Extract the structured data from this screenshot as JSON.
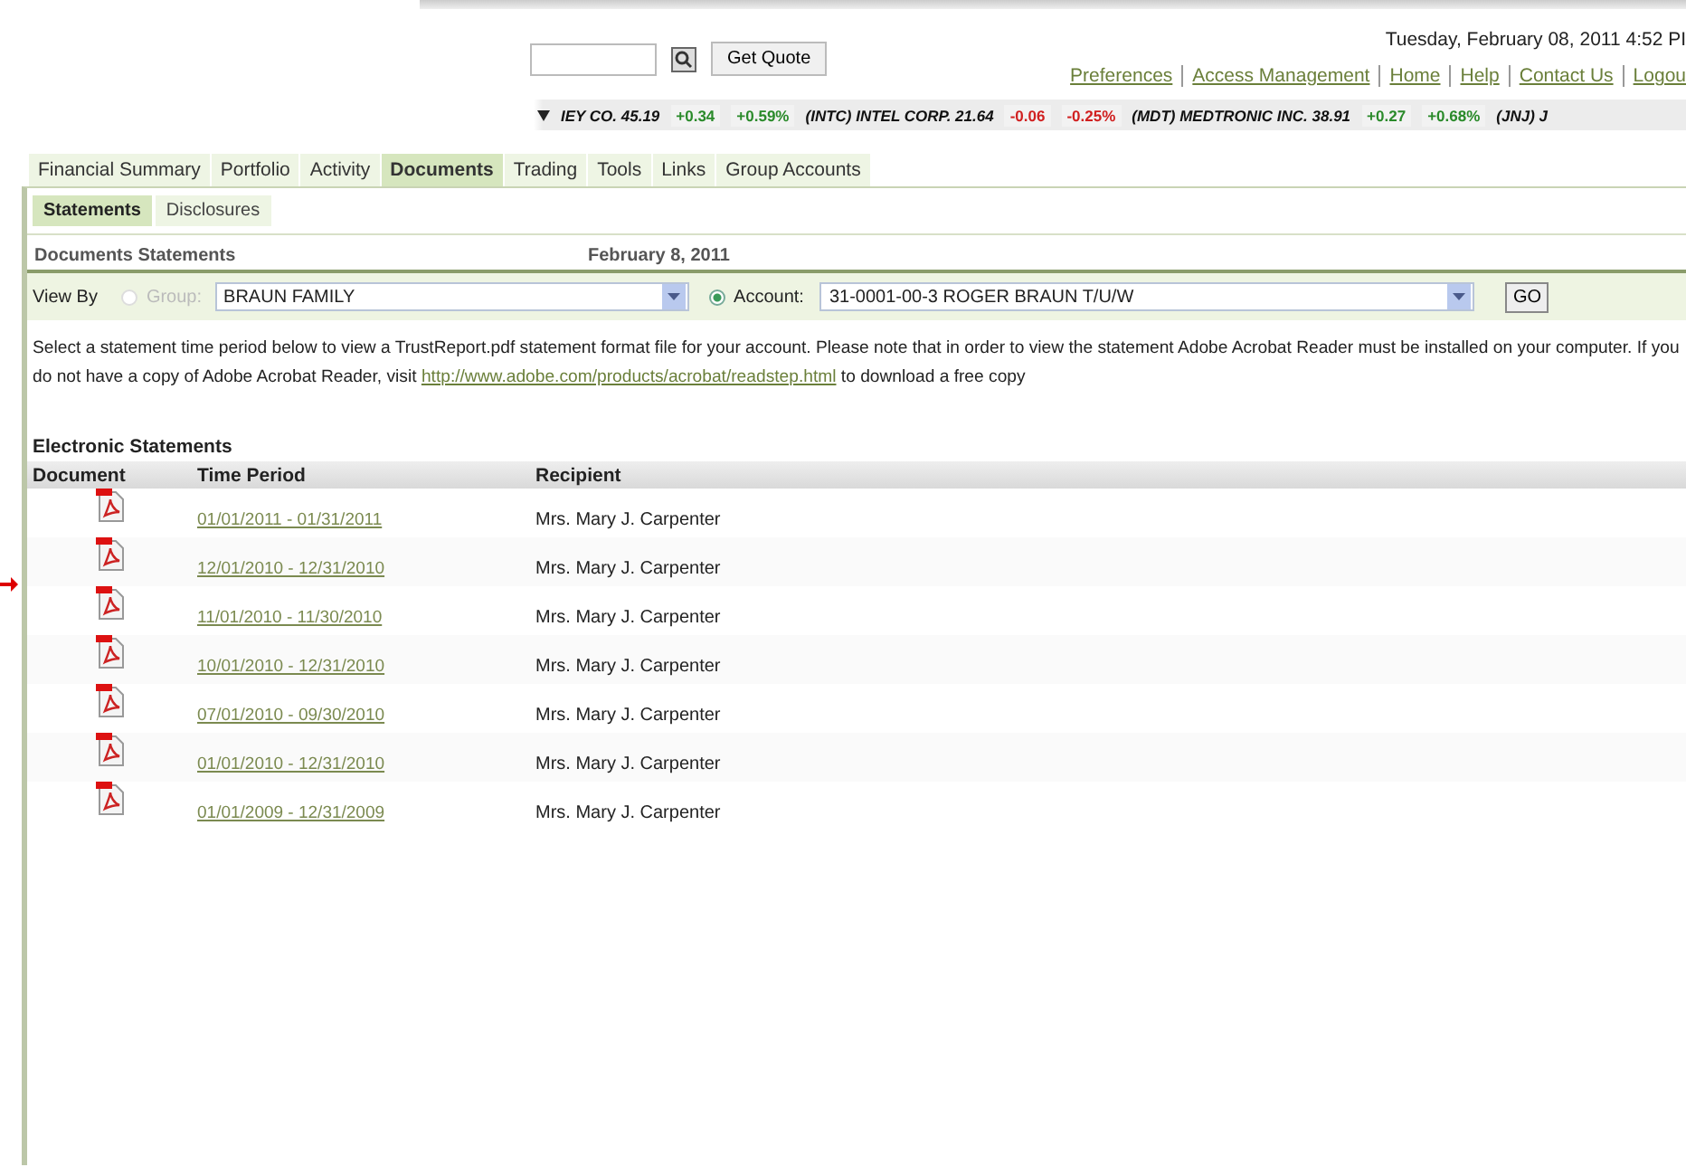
{
  "quote": {
    "button": "Get Quote"
  },
  "datetime": "Tuesday, February 08, 2011 4:52 PI",
  "top_links": [
    "Preferences",
    "Access Management",
    "Home",
    "Help",
    "Contact Us",
    "Logou"
  ],
  "ticker": [
    {
      "name": "IEY CO. 45.19",
      "change": "+0.34",
      "percent": "+0.59%",
      "color": "#2a8a2a"
    },
    {
      "name": "(INTC) INTEL CORP. 21.64",
      "change": "-0.06",
      "percent": "-0.25%",
      "color": "#d02020"
    },
    {
      "name": "(MDT) MEDTRONIC INC. 38.91",
      "change": "+0.27",
      "percent": "+0.68%",
      "color": "#2a8a2a"
    },
    {
      "name": "(JNJ) J"
    }
  ],
  "tabs": [
    {
      "label": "Financial Summary",
      "selected": false
    },
    {
      "label": "Portfolio",
      "selected": false
    },
    {
      "label": "Activity",
      "selected": false
    },
    {
      "label": "Documents",
      "selected": true
    },
    {
      "label": "Trading",
      "selected": false
    },
    {
      "label": "Tools",
      "selected": false
    },
    {
      "label": "Links",
      "selected": false
    },
    {
      "label": "Group Accounts",
      "selected": false
    }
  ],
  "subtabs": [
    {
      "label": "Statements",
      "selected": true
    },
    {
      "label": "Disclosures",
      "selected": false
    }
  ],
  "section": {
    "title": "Documents Statements",
    "date": "February 8, 2011"
  },
  "view_by": {
    "label": "View By",
    "group": {
      "label": "Group:",
      "selected": false,
      "disabled": true
    },
    "group_value": "BRAUN FAMILY",
    "account": {
      "label": "Account:",
      "selected": true
    },
    "account_value": "31-0001-00-3 ROGER BRAUN T/U/W",
    "go": "GO"
  },
  "instructions": {
    "before": "Select a statement time period below to view a TrustReport.pdf statement format file for your account. Please note that in order to view the statement Adobe Acrobat Reader must be installed on your computer. If you do not have a copy of Adobe Acrobat Reader, visit",
    "link": "http://www.adobe.com/products/acrobat/readstep.html",
    "after": "to download a free copy"
  },
  "statements": {
    "title": "Electronic Statements",
    "columns": [
      "Document",
      "Time Period",
      "Recipient"
    ],
    "rows": [
      {
        "period": "01/01/2011 - 01/31/2011",
        "recipient": "Mrs. Mary J. Carpenter"
      },
      {
        "period": "12/01/2010 - 12/31/2010",
        "recipient": "Mrs. Mary J. Carpenter"
      },
      {
        "period": "11/01/2010 - 11/30/2010",
        "recipient": "Mrs. Mary J. Carpenter"
      },
      {
        "period": "10/01/2010 - 12/31/2010",
        "recipient": "Mrs. Mary J. Carpenter"
      },
      {
        "period": "07/01/2010 - 09/30/2010",
        "recipient": "Mrs. Mary J. Carpenter"
      },
      {
        "period": "01/01/2010 - 12/31/2010",
        "recipient": "Mrs. Mary J. Carpenter"
      },
      {
        "period": "01/01/2009 - 12/31/2009",
        "recipient": "Mrs. Mary J. Carpenter"
      }
    ]
  }
}
